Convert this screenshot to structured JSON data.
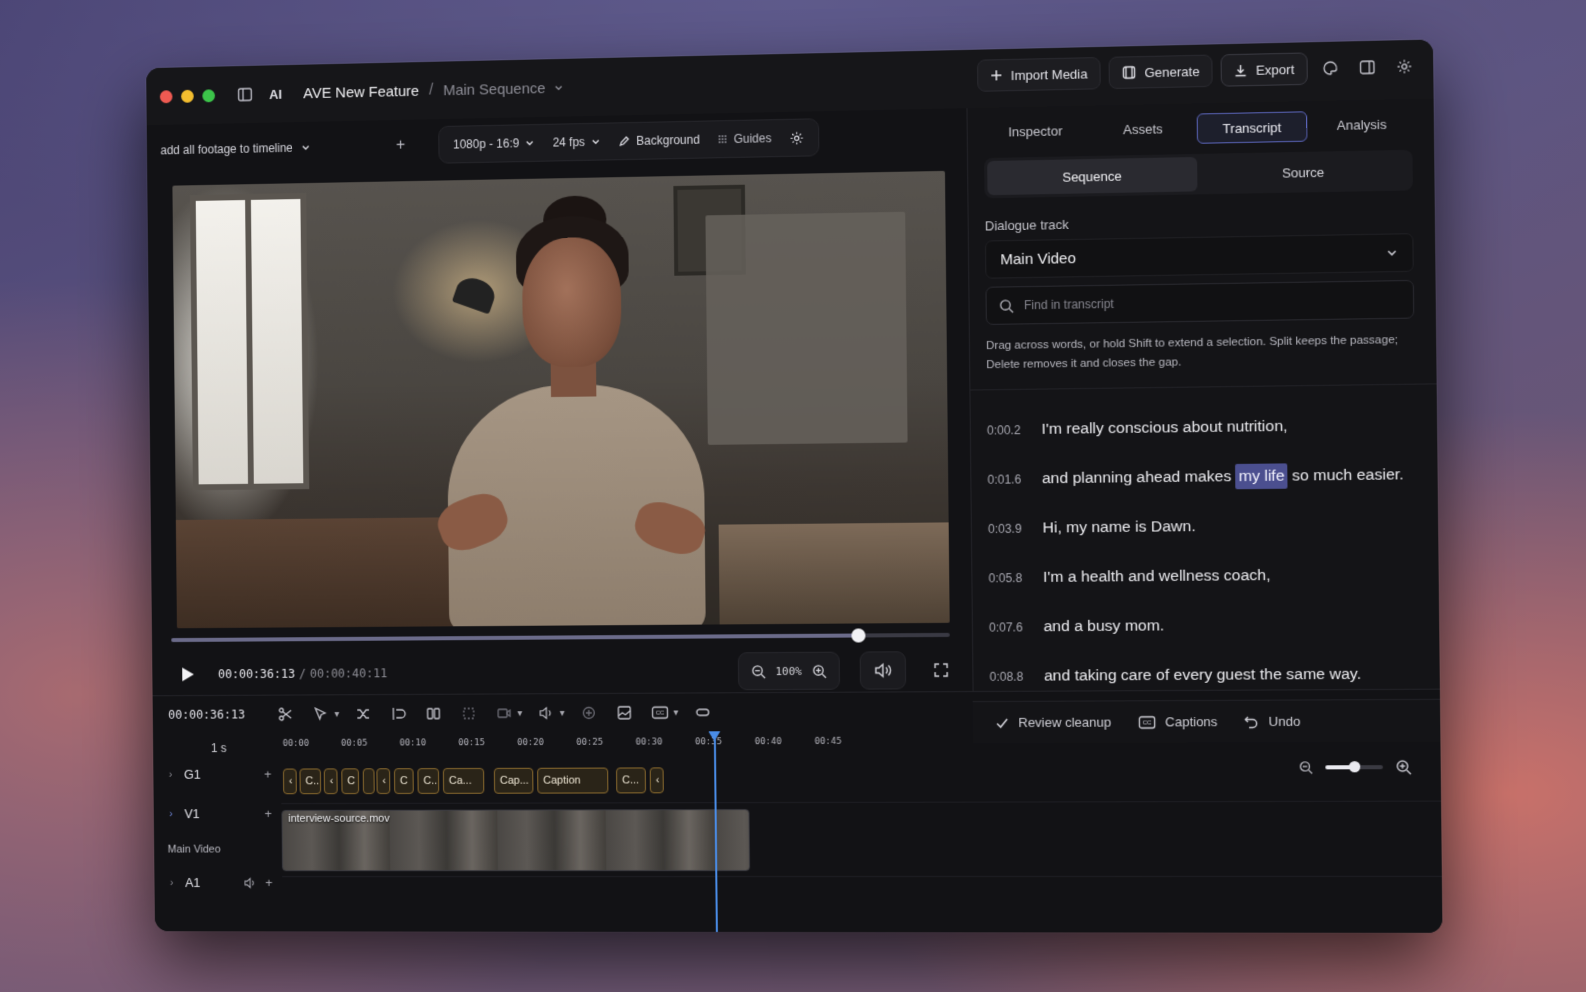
{
  "window": {
    "ai_label": "AI",
    "project": "AVE New Feature",
    "separator": "/",
    "sequence": "Main Sequence"
  },
  "header": {
    "import_label": "Import Media",
    "generate_label": "Generate",
    "export_label": "Export"
  },
  "viewer": {
    "clip_select": "add all footage to timeline",
    "add_symbol": "+",
    "resolution": "1080p - 16:9",
    "fps": "24 fps",
    "background_label": "Background",
    "guides_label": "Guides",
    "current_tc": "00:00:36:13",
    "tc_separator": "/",
    "total_tc": "00:00:40:11",
    "progress": 0.885,
    "zoom": "100%"
  },
  "panel": {
    "tabs": [
      {
        "label": "Inspector"
      },
      {
        "label": "Assets"
      },
      {
        "label": "Transcript"
      },
      {
        "label": "Analysis"
      }
    ],
    "active_tab": "Transcript",
    "segments": [
      {
        "label": "Sequence"
      },
      {
        "label": "Source"
      }
    ],
    "dialogue_label": "Dialogue track",
    "dialogue_value": "Main Video",
    "find_placeholder": "Find in transcript",
    "hint": "Drag across words, or hold Shift to extend a selection. Split keeps the passage; Delete removes it and closes the gap.",
    "lines": [
      {
        "time": "0:00.2",
        "before": "I'm really conscious about nutrition,",
        "highlight": "",
        "after": ""
      },
      {
        "time": "0:01.6",
        "before": "and planning ahead makes",
        "highlight": "my life",
        "after": "so much easier."
      },
      {
        "time": "0:03.9",
        "before": "Hi, my name is Dawn.",
        "highlight": "",
        "after": ""
      },
      {
        "time": "0:05.8",
        "before": "I'm a health and wellness coach,",
        "highlight": "",
        "after": ""
      },
      {
        "time": "0:07.6",
        "before": "and a busy mom.",
        "highlight": "",
        "after": ""
      },
      {
        "time": "0:08.8",
        "before": "and taking care of every guest the same way.",
        "highlight": "",
        "after": ""
      }
    ],
    "actions": {
      "review": "Review cleanup",
      "captions": "Captions",
      "undo": "Undo"
    }
  },
  "timeline": {
    "current_tc": "00:00:36:13",
    "scale": "1 s",
    "ticks": [
      "00:00",
      "00:05",
      "00:10",
      "00:15",
      "00:20",
      "00:25",
      "00:30",
      "00:35",
      "00:40",
      "00:45"
    ],
    "tracks": {
      "g1": "G1",
      "v1": "V1",
      "v1_sub": "Main Video",
      "a1": "A1",
      "add": "+"
    },
    "captions": [
      "‹",
      "C...",
      "‹",
      "C",
      "",
      "‹",
      "C",
      "C...",
      "Ca...",
      "Cap...",
      "Caption",
      "C...",
      "‹"
    ],
    "video_clip": "interview-source.mov",
    "zoom_level": 0.5
  }
}
